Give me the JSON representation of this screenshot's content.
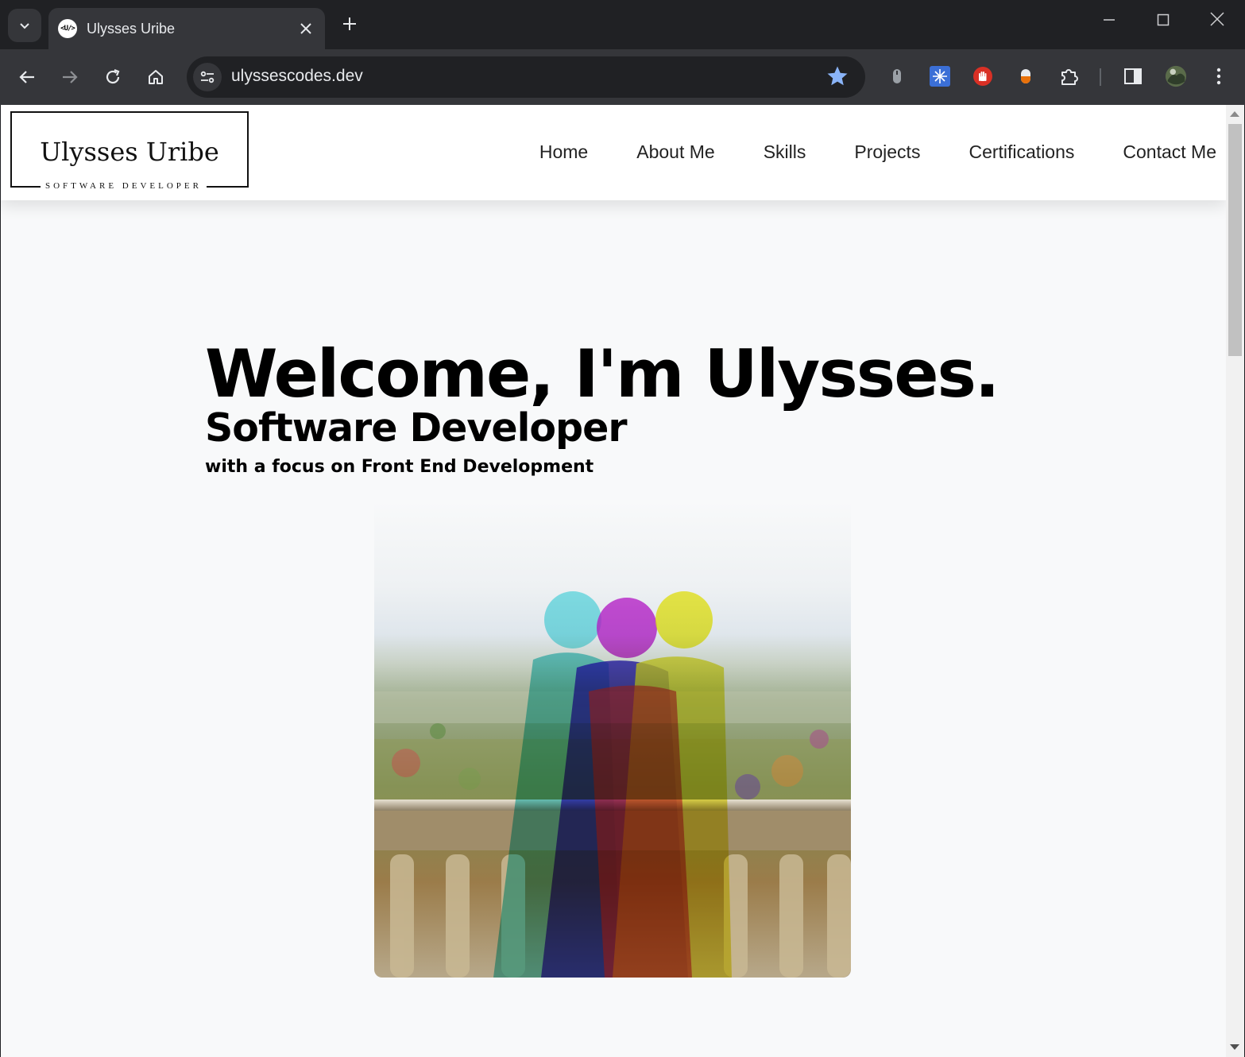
{
  "browser": {
    "tab_title": "Ulysses Uribe",
    "favicon_text": "<U/>",
    "url": "ulyssescodes.dev",
    "icons": [
      "tab-search-icon",
      "close-icon",
      "plus-icon",
      "minimize-icon",
      "maximize-icon",
      "close-window-icon",
      "back-arrow-icon",
      "forward-arrow-icon",
      "reload-icon",
      "home-icon",
      "site-info-icon",
      "star-icon",
      "extension-icon",
      "puzzle-icon",
      "side-panel-icon",
      "profile-avatar-icon",
      "kebab-menu-icon"
    ],
    "accent_color": "#8ab4f8"
  },
  "site": {
    "logo": {
      "name": "Ulysses Uribe",
      "subtitle": "SOFTWARE DEVELOPER"
    },
    "nav": [
      {
        "label": "Home"
      },
      {
        "label": "About Me"
      },
      {
        "label": "Skills"
      },
      {
        "label": "Projects"
      },
      {
        "label": "Certifications"
      },
      {
        "label": "Contact Me"
      }
    ],
    "hero": {
      "headline": "Welcome, I'm Ulysses.",
      "role": "Software Developer",
      "focus": "with a focus on Front End Development"
    }
  }
}
